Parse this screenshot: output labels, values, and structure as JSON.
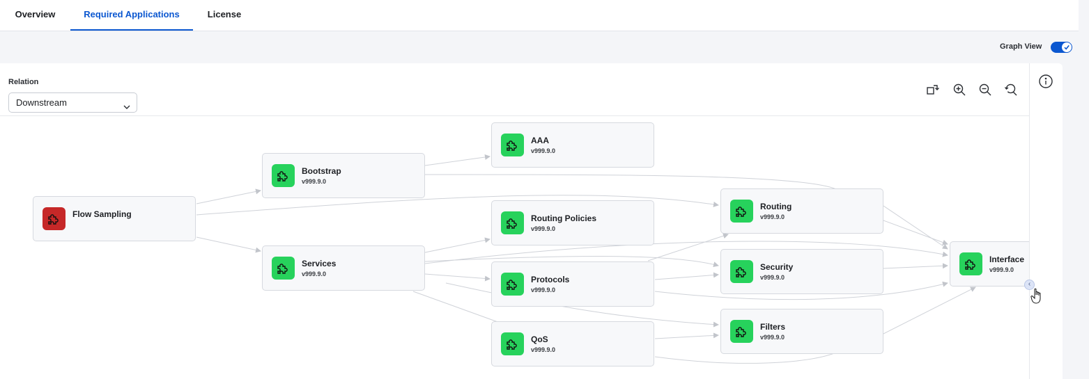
{
  "tabs": [
    {
      "label": "Overview",
      "active": false
    },
    {
      "label": "Required Applications",
      "active": true
    },
    {
      "label": "License",
      "active": false
    }
  ],
  "graph_view": {
    "label": "Graph View",
    "enabled": true
  },
  "relation": {
    "label": "Relation",
    "selected": "Downstream"
  },
  "toolbar": {
    "icons": [
      "layout-icon",
      "zoom-in-icon",
      "zoom-out-icon",
      "reset-zoom-icon"
    ]
  },
  "info_icon": "info-icon",
  "colors": {
    "accent": "#0b57d0",
    "node_ok": "#27d25c",
    "node_error": "#c62828"
  },
  "nodes": [
    {
      "id": "flow-sampling",
      "name": "Flow Sampling",
      "version": "",
      "status": "error"
    },
    {
      "id": "bootstrap",
      "name": "Bootstrap",
      "version": "v999.9.0",
      "status": "ok"
    },
    {
      "id": "services",
      "name": "Services",
      "version": "v999.9.0",
      "status": "ok"
    },
    {
      "id": "aaa",
      "name": "AAA",
      "version": "v999.9.0",
      "status": "ok"
    },
    {
      "id": "routing-policies",
      "name": "Routing Policies",
      "version": "v999.9.0",
      "status": "ok"
    },
    {
      "id": "protocols",
      "name": "Protocols",
      "version": "v999.9.0",
      "status": "ok"
    },
    {
      "id": "qos",
      "name": "QoS",
      "version": "v999.9.0",
      "status": "ok"
    },
    {
      "id": "routing",
      "name": "Routing",
      "version": "v999.9.0",
      "status": "ok"
    },
    {
      "id": "security",
      "name": "Security",
      "version": "v999.9.0",
      "status": "ok"
    },
    {
      "id": "filters",
      "name": "Filters",
      "version": "v999.9.0",
      "status": "ok"
    },
    {
      "id": "interface",
      "name": "Interface",
      "version": "v999.9.0",
      "status": "ok"
    }
  ]
}
